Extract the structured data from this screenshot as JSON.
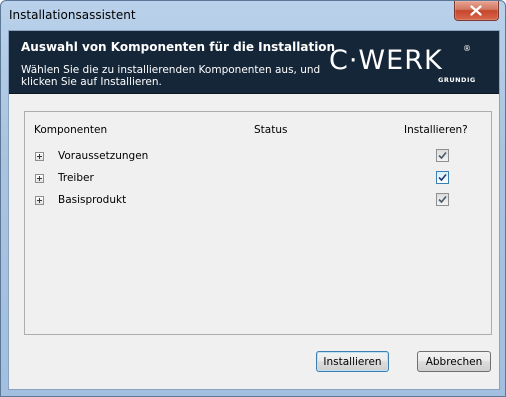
{
  "window": {
    "title": "Installationsassistent"
  },
  "banner": {
    "title": "Auswahl von Komponenten für die Installation",
    "subtitle": "Wählen Sie die zu installierenden Komponenten aus, und klicken Sie auf Installieren.",
    "logo_text": "C·WERK",
    "logo_reg": "®",
    "logo_brand": "GRUNDIG"
  },
  "table": {
    "headers": {
      "components": "Komponenten",
      "status": "Status",
      "install": "Installieren?"
    },
    "rows": [
      {
        "label": "Voraussetzungen",
        "status": "",
        "checked": true,
        "focused": false
      },
      {
        "label": "Treiber",
        "status": "",
        "checked": true,
        "focused": true
      },
      {
        "label": "Basisprodukt",
        "status": "",
        "checked": true,
        "focused": false
      }
    ]
  },
  "buttons": {
    "install": "Installieren",
    "cancel": "Abbrechen"
  },
  "icons": {
    "close": "close-icon",
    "expand": "plus-expander-icon",
    "check": "checkmark-icon"
  },
  "colors": {
    "banner_bg": "#152638",
    "close_red": "#c6452c",
    "focus_blue": "#3c7fb1"
  }
}
